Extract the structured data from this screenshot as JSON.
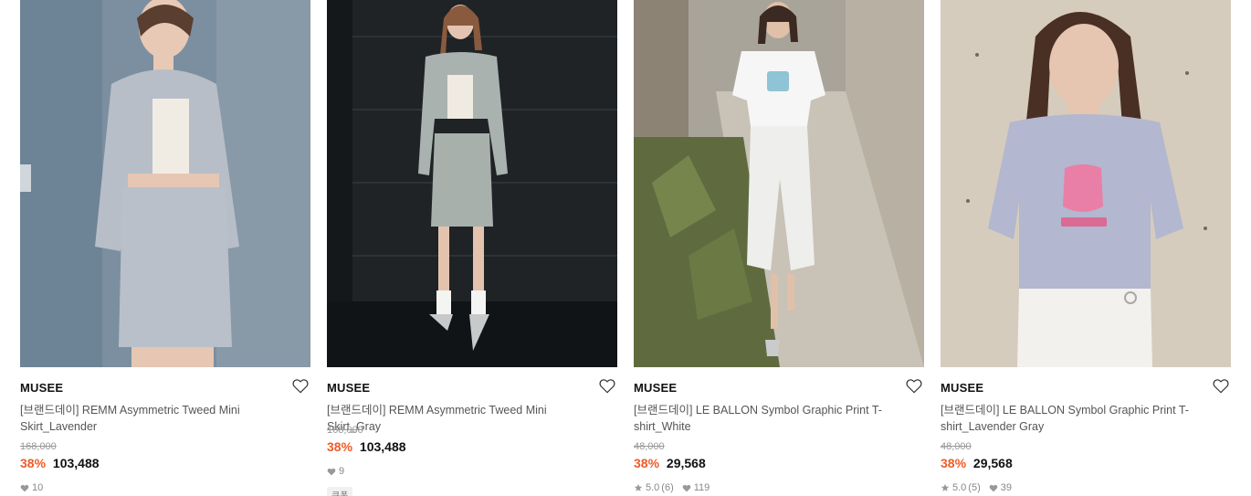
{
  "products": [
    {
      "brand": "MUSEE",
      "title": "[브랜드데이] REMM Asymmetric Tweed Mini Skirt_Lavender",
      "original_price": "168,000",
      "discount": "38%",
      "price": "103,488",
      "likes": "10"
    },
    {
      "brand": "MUSEE",
      "title": "[브랜드데이] REMM Asymmetric Tweed Mini Skirt_Gray",
      "original_price": "168,000",
      "discount": "38%",
      "price": "103,488",
      "likes": "9",
      "badge": "쿠폰"
    },
    {
      "brand": "MUSEE",
      "title": "[브랜드데이] LE BALLON Symbol Graphic Print T-shirt_White",
      "original_price": "48,000",
      "discount": "38%",
      "price": "29,568",
      "rating": "5.0",
      "review_count": "(6)",
      "likes": "119"
    },
    {
      "brand": "MUSEE",
      "title": "[브랜드데이] LE BALLON Symbol Graphic Print T-shirt_Lavender Gray",
      "original_price": "48,000",
      "discount": "38%",
      "price": "29,568",
      "rating": "5.0",
      "review_count": "(5)",
      "likes": "39"
    }
  ],
  "icons": {
    "wishlist": "heart-outline-icon",
    "likes": "heart-filled-icon",
    "rating": "star-icon"
  },
  "colors": {
    "discount": "#f15a24",
    "text": "#222222",
    "muted": "#999999"
  }
}
